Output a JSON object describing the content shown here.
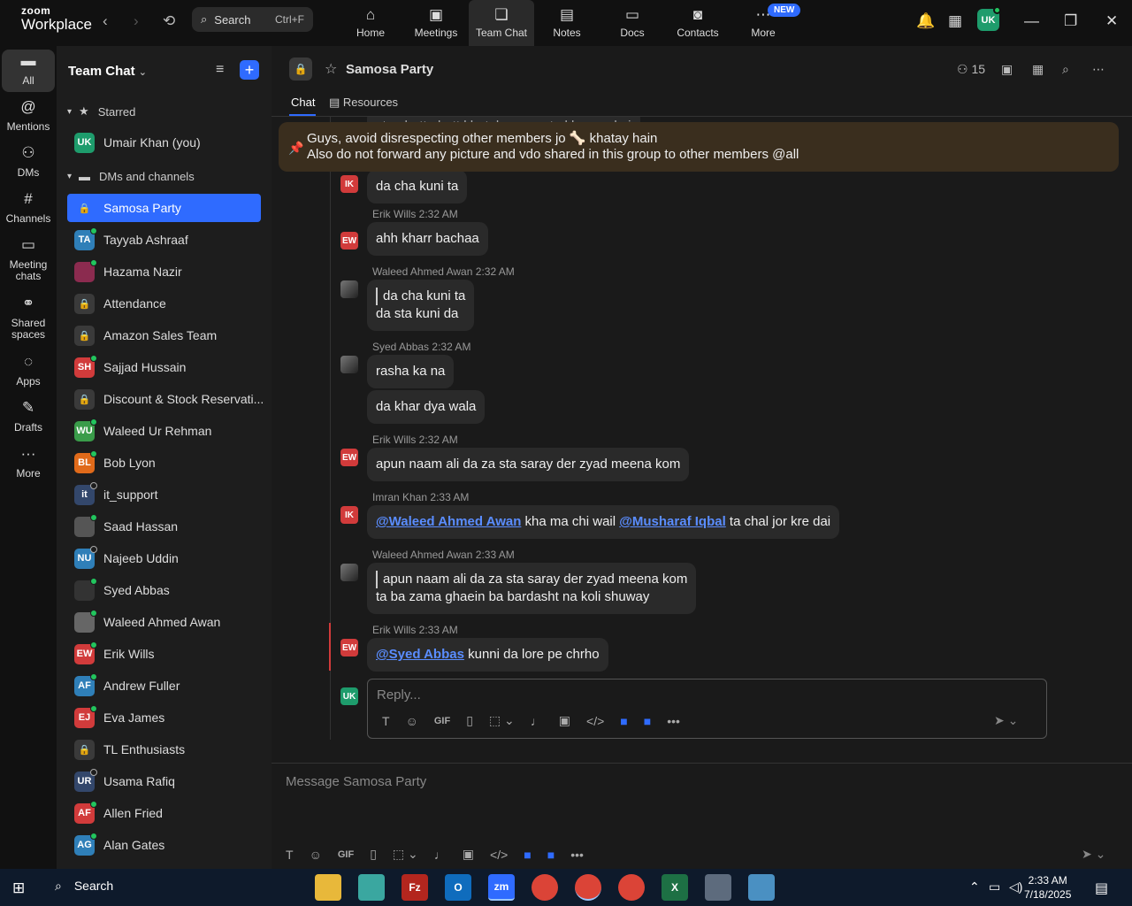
{
  "app": {
    "brand_top": "zoom",
    "brand_bottom": "Workplace"
  },
  "search": {
    "label": "Search",
    "shortcut": "Ctrl+F"
  },
  "topnav": [
    {
      "label": "Home",
      "icon": "home-icon"
    },
    {
      "label": "Meetings",
      "icon": "video-icon"
    },
    {
      "label": "Team Chat",
      "icon": "chat-icon",
      "active": true
    },
    {
      "label": "Notes",
      "icon": "notes-icon"
    },
    {
      "label": "Docs",
      "icon": "docs-icon"
    },
    {
      "label": "Contacts",
      "icon": "contacts-icon"
    },
    {
      "label": "More",
      "icon": "more-icon",
      "badge": "NEW"
    }
  ],
  "user_initials": "UK",
  "rail": [
    {
      "label": "All",
      "active": true
    },
    {
      "label": "Mentions"
    },
    {
      "label": "DMs"
    },
    {
      "label": "Channels"
    },
    {
      "label": "Meeting chats"
    },
    {
      "label": "Shared spaces"
    },
    {
      "label": "Apps"
    },
    {
      "label": "Drafts"
    },
    {
      "label": "More"
    }
  ],
  "sidebar": {
    "title": "Team Chat",
    "section_starred": "Starred",
    "starred": [
      {
        "name": "Umair Khan (you)",
        "initials": "UK",
        "color": "#1e9c6c"
      }
    ],
    "section_dms": "DMs and channels",
    "items": [
      {
        "name": "Samosa Party",
        "type": "lock",
        "active": true
      },
      {
        "name": "Tayyab Ashraaf",
        "initials": "TA",
        "color": "#2f7fb8"
      },
      {
        "name": "Hazama Nazir",
        "initials": "",
        "color": "#8b2b4f"
      },
      {
        "name": "Attendance",
        "type": "lock"
      },
      {
        "name": "Amazon Sales Team",
        "type": "lock"
      },
      {
        "name": "Sajjad Hussain",
        "initials": "SH",
        "color": "#d13b3b"
      },
      {
        "name": "Discount & Stock Reservati...",
        "type": "lock"
      },
      {
        "name": "Waleed Ur Rehman",
        "initials": "WU",
        "color": "#3a9c4a"
      },
      {
        "name": "Bob Lyon",
        "initials": "BL",
        "color": "#e06a1a"
      },
      {
        "name": "it_support",
        "initials": "it",
        "color": "#33476b"
      },
      {
        "name": "Saad Hassan",
        "initials": "",
        "color": "#555"
      },
      {
        "name": "Najeeb Uddin",
        "initials": "NU",
        "color": "#2f7fb8"
      },
      {
        "name": "Syed Abbas",
        "initials": "",
        "color": "#333"
      },
      {
        "name": "Waleed Ahmed Awan",
        "initials": "",
        "color": "#666"
      },
      {
        "name": "Erik Wills",
        "initials": "EW",
        "color": "#d13b3b"
      },
      {
        "name": "Andrew Fuller",
        "initials": "AF",
        "color": "#2f7fb8"
      },
      {
        "name": "Eva James",
        "initials": "EJ",
        "color": "#d13b3b"
      },
      {
        "name": "TL Enthusiasts",
        "type": "lock"
      },
      {
        "name": "Usama Rafiq",
        "initials": "UR",
        "color": "#33476b"
      },
      {
        "name": "Allen Fried",
        "initials": "AF",
        "color": "#d13b3b"
      },
      {
        "name": "Alan Gates",
        "initials": "AG",
        "color": "#2f7fb8"
      }
    ]
  },
  "channel": {
    "title": "Samosa Party",
    "members": "15",
    "tab_chat": "Chat",
    "tab_resources": "Resources"
  },
  "pinned": {
    "line1": "Guys, avoid disrespecting other members jo 🦴 khatay hain",
    "line2": "Also do not forward any picture and vdo shared in this group to other members @all"
  },
  "partial_top": "sta ghatt ghatt khatakay maa ta khwann kai",
  "messages": [
    {
      "author": "",
      "time": "",
      "text": "da cha kuni ta"
    },
    {
      "author": "Erik Wills",
      "time": "2:32 AM",
      "text": "ahh kharr bachaa"
    },
    {
      "author": "Waleed Ahmed Awan",
      "time": "2:32 AM",
      "quote": "da cha kuni ta",
      "text": "da sta kuni da"
    },
    {
      "author": "Syed Abbas",
      "time": "2:32 AM",
      "text": "rasha ka na",
      "text2": "da khar dya wala"
    },
    {
      "author": "Erik Wills",
      "time": "2:32 AM",
      "text": "apun naam ali da za sta saray der zyad meena kom"
    },
    {
      "author": "Imran Khan",
      "time": "2:33 AM",
      "mention1": "@Waleed Ahmed Awan",
      "mid": " kha ma chi wail ",
      "mention2": "@Musharaf Iqbal",
      "tail": " ta chal jor kre dai"
    },
    {
      "author": "Waleed Ahmed Awan",
      "time": "2:33 AM",
      "quote": "apun naam ali da za sta saray der zyad meena kom",
      "text": "ta ba zama ghaein ba bardasht na koli shuway"
    },
    {
      "author": "Erik Wills",
      "time": "2:33 AM",
      "mention1": "@Syed Abbas",
      "tail": " kunni da lore pe chrho"
    }
  ],
  "avatar_initials": {
    "ik": "IK",
    "ew": "EW",
    "uk": "UK"
  },
  "reply": {
    "placeholder": "Reply..."
  },
  "composer": {
    "placeholder": "Message Samosa Party"
  },
  "taskbar": {
    "search": "Search",
    "time": "2:33 AM",
    "date": "7/18/2025"
  },
  "colors": {
    "accent": "#2f6bff",
    "pin_bg": "#3a2e1e",
    "online": "#22c55e"
  }
}
